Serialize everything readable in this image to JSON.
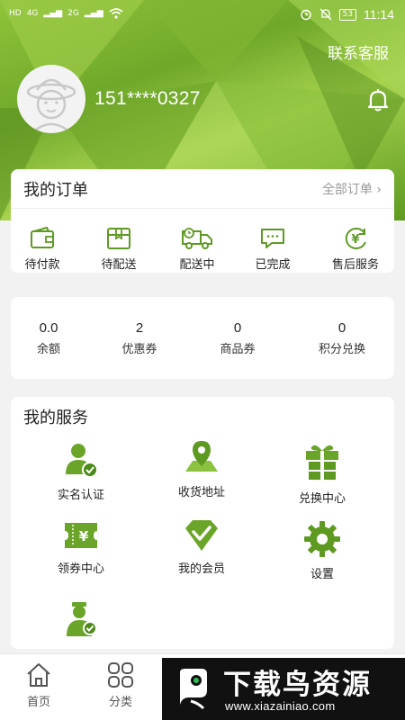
{
  "status_bar": {
    "left_indicators": [
      "HD",
      "4G",
      "2G"
    ],
    "battery": "53",
    "time": "11:14"
  },
  "header": {
    "contact_label": "联系客服",
    "phone": "151****0327"
  },
  "orders": {
    "title": "我的订单",
    "all_label": "全部订单 ›",
    "items": [
      {
        "label": "待付款",
        "icon": "wallet-icon"
      },
      {
        "label": "待配送",
        "icon": "package-icon"
      },
      {
        "label": "配送中",
        "icon": "truck-icon"
      },
      {
        "label": "已完成",
        "icon": "chat-icon"
      },
      {
        "label": "售后服务",
        "icon": "yuan-refresh-icon"
      }
    ]
  },
  "balances": [
    {
      "value": "0.0",
      "label": "余额"
    },
    {
      "value": "2",
      "label": "优惠券"
    },
    {
      "value": "0",
      "label": "商品券"
    },
    {
      "value": "0",
      "label": "积分兑换"
    }
  ],
  "services": {
    "title": "我的服务",
    "items": [
      {
        "label": "实名认证",
        "icon": "user-verified-icon"
      },
      {
        "label": "收货地址",
        "icon": "map-pin-icon"
      },
      {
        "label": "兑换中心",
        "icon": "gift-icon"
      },
      {
        "label": "领券中心",
        "icon": "coupon-icon"
      },
      {
        "label": "我的会员",
        "icon": "diamond-check-icon"
      },
      {
        "label": "设置",
        "icon": "gear-icon"
      },
      {
        "label": "",
        "icon": "staff-icon"
      }
    ]
  },
  "tabbar": [
    {
      "label": "首页",
      "icon": "home-icon"
    },
    {
      "label": "分类",
      "icon": "grid-icon"
    }
  ],
  "watermark": {
    "title": "下载鸟资源",
    "url": "www.xiazainiao.com"
  },
  "colors": {
    "accent_green": "#6aa52a",
    "header_green": "#8fc43a",
    "background": "#f2f2f2"
  }
}
